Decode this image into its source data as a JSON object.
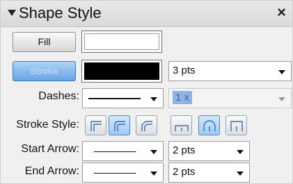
{
  "panel": {
    "title": "Shape Style",
    "close_glyph": "×"
  },
  "fill": {
    "button_label": "Fill",
    "swatch_color": "#ffffff"
  },
  "stroke": {
    "button_label": "Stroke",
    "button_active": true,
    "swatch_color": "#000000",
    "width_value": "3 pts"
  },
  "dashes": {
    "label": "Dashes:",
    "style": "solid",
    "scale_value": "1 x",
    "scale_enabled": false
  },
  "stroke_style": {
    "label": "Stroke Style:",
    "join_icons": [
      {
        "name": "miter-join-icon",
        "selected": false
      },
      {
        "name": "round-join-icon",
        "selected": true
      },
      {
        "name": "bevel-join-icon",
        "selected": false
      }
    ],
    "cap_icons": [
      {
        "name": "butt-cap-icon",
        "selected": false
      },
      {
        "name": "round-cap-icon",
        "selected": true
      },
      {
        "name": "square-cap-icon",
        "selected": false
      }
    ]
  },
  "start_arrow": {
    "label": "Start Arrow:",
    "style": "none",
    "size_value": "2 pts"
  },
  "end_arrow": {
    "label": "End Arrow:",
    "style": "none",
    "size_value": "2 pts"
  }
}
